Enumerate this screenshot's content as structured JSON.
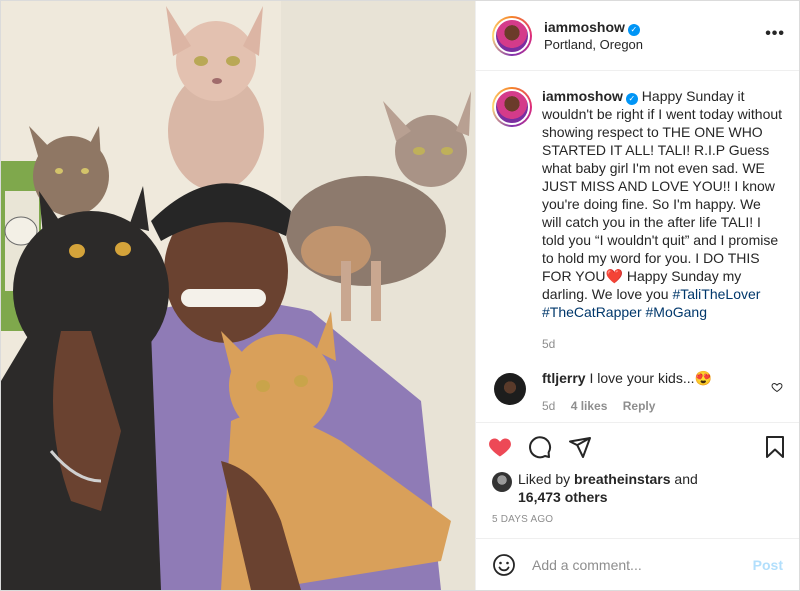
{
  "post": {
    "username": "iammoshow",
    "location": "Portland, Oregon",
    "more_icon": "more-horizontal-icon",
    "verified_icon": "verified-badge-icon"
  },
  "caption": {
    "username": "iammoshow",
    "text": "Happy Sunday it wouldn't be right if I went today without showing respect to THE ONE WHO STARTED IT ALL! TALI! R.I.P Guess what baby girl I'm not even sad. WE JUST MISS AND LOVE YOU!! I know you're doing fine. So I'm happy. We will catch you in the after life TALI! I told you “I wouldn't quit” and I promise to hold my word for you. I DO THIS FOR YOU",
    "heart_emoji": "❤️",
    "text_after": " Happy Sunday my darling. We love you ",
    "hashtags": [
      "#TaliTheLover",
      "#TheCatRapper",
      "#MoGang"
    ],
    "age": "5d"
  },
  "comment": {
    "username": "ftljerry",
    "text": "I love your kids...",
    "emoji": "😍",
    "age": "5d",
    "likes": "4 likes",
    "reply": "Reply"
  },
  "actions": {
    "like_icon": "heart-filled-icon",
    "comment_icon": "comment-icon",
    "share_icon": "share-icon",
    "save_icon": "bookmark-icon",
    "like_color": "#ed4956"
  },
  "likes": {
    "prefix": "Liked by ",
    "user": "breatheinstars",
    "mid": " and",
    "count": "16,473 others"
  },
  "timestamp": "5 DAYS AGO",
  "add_comment": {
    "placeholder": "Add a comment...",
    "post_label": "Post",
    "emoji_icon": "smiley-icon"
  }
}
